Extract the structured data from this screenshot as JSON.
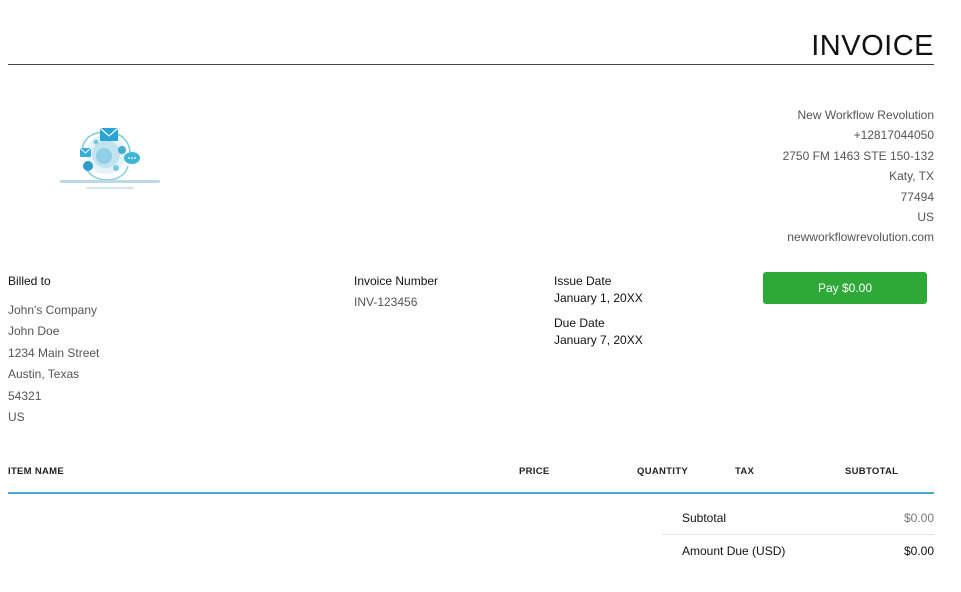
{
  "header": {
    "title": "INVOICE"
  },
  "logo": {
    "icon": "envelope-network-logo-icon",
    "brand_color": "#3fb6d6"
  },
  "company": {
    "name": "New Workflow Revolution",
    "phone": "+12817044050",
    "address": "2750 FM 1463 STE 150-132",
    "city_state": "Katy, TX",
    "zip": "77494",
    "country": "US",
    "website": "newworkflowrevolution.com"
  },
  "billed_to": {
    "label": "Billed to",
    "company": "John's Company",
    "name": "John Doe",
    "street": "1234 Main Street",
    "city_state": "Austin, Texas",
    "zip": "54321",
    "country": "US"
  },
  "invoice": {
    "number_label": "Invoice Number",
    "number": "INV-123456",
    "issue_date_label": "Issue Date",
    "issue_date": "January 1, 20XX",
    "due_date_label": "Due Date",
    "due_date": "January 7, 20XX"
  },
  "pay_button": {
    "label": "Pay $0.00",
    "color": "#2ea836"
  },
  "table": {
    "columns": {
      "item_name": "ITEM NAME",
      "price": "PRICE",
      "quantity": "QUANTITY",
      "tax": "TAX",
      "subtotal": "SUBTOTAL"
    },
    "rule_color": "#4aa8d8"
  },
  "totals": {
    "subtotal_label": "Subtotal",
    "subtotal_value": "$0.00",
    "amount_due_label": "Amount Due (USD)",
    "amount_due_value": "$0.00"
  }
}
